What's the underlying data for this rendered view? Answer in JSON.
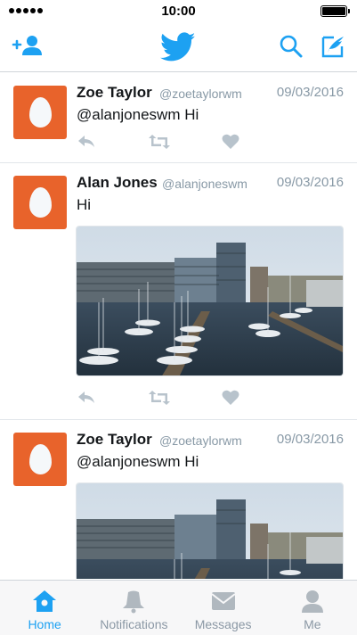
{
  "status_bar": {
    "time": "10:00",
    "signal_dots": 5,
    "battery_level": 1.0
  },
  "nav": {
    "icons": [
      "add-user-icon",
      "twitter-bird-icon",
      "search-icon",
      "compose-icon"
    ],
    "accent_color": "#1da1f2"
  },
  "colors": {
    "avatar_bg": "#e8632b",
    "muted_text": "#8899a6",
    "action_icon": "#b8c3cc"
  },
  "tweets": [
    {
      "name": "Zoe Taylor",
      "handle": "@zoetaylorwm",
      "date": "09/03/2016",
      "text": "@alanjoneswm Hi",
      "has_media": false
    },
    {
      "name": "Alan Jones",
      "handle": "@alanjoneswm",
      "date": "09/03/2016",
      "text": "Hi",
      "has_media": true,
      "media_alt": "harbour-photo"
    },
    {
      "name": "Zoe Taylor",
      "handle": "@zoetaylorwm",
      "date": "09/03/2016",
      "text": "@alanjoneswm Hi",
      "has_media": true,
      "media_alt": "harbour-photo"
    }
  ],
  "tabs": [
    {
      "label": "Home",
      "icon": "home-icon",
      "active": true
    },
    {
      "label": "Notifications",
      "icon": "bell-icon",
      "active": false
    },
    {
      "label": "Messages",
      "icon": "envelope-icon",
      "active": false
    },
    {
      "label": "Me",
      "icon": "person-icon",
      "active": false
    }
  ]
}
